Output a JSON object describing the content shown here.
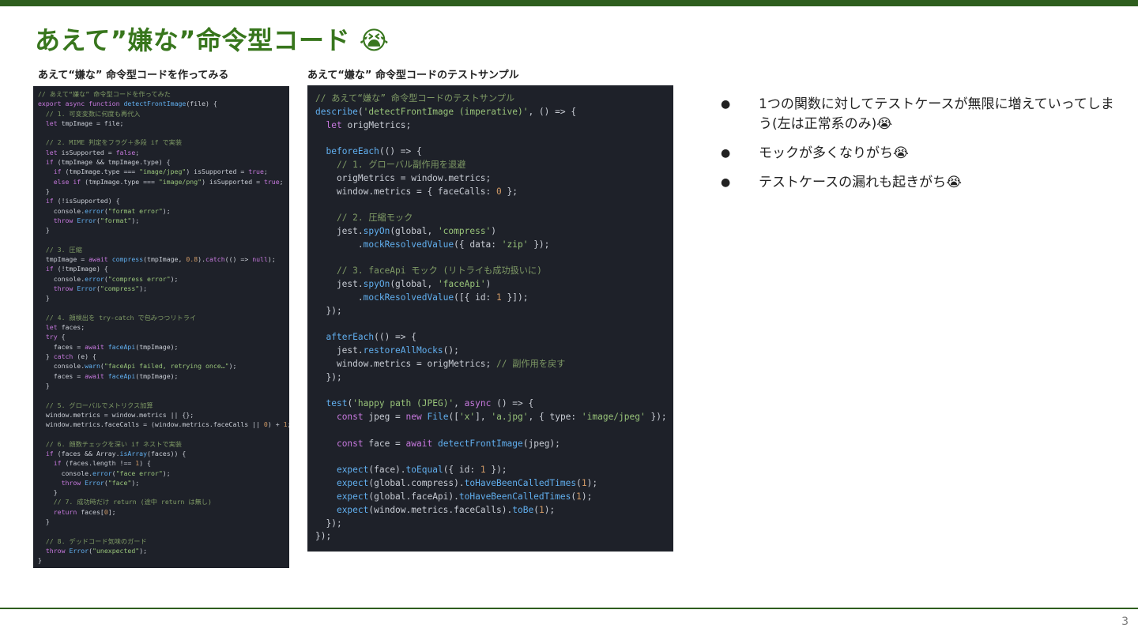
{
  "title": "あえて”嫌な”命令型コード",
  "title_emoji": "😭",
  "left_panel": {
    "caption": "あえて“嫌な” 命令型コードを作ってみる",
    "code_lines": [
      "// あえて“嫌な” 命令型コードを作ってみた",
      "export async function detectFrontImage(file) {",
      "  // 1. 可変変数に何度も再代入",
      "  let tmpImage = file;",
      "",
      "  // 2. MIME 判定をフラグ＋多段 if で実装",
      "  let isSupported = false;",
      "  if (tmpImage && tmpImage.type) {",
      "    if (tmpImage.type === \"image/jpeg\") isSupported = true;",
      "    else if (tmpImage.type === \"image/png\") isSupported = true;",
      "  }",
      "  if (!isSupported) {",
      "    console.error(\"format error\");",
      "    throw Error(\"format\");",
      "  }",
      "",
      "  // 3. 圧縮",
      "  tmpImage = await compress(tmpImage, 0.8).catch(() => null);",
      "  if (!tmpImage) {",
      "    console.error(\"compress error\");",
      "    throw Error(\"compress\");",
      "  }",
      "",
      "  // 4. 顔検出を try-catch で包みつつリトライ",
      "  let faces;",
      "  try {",
      "    faces = await faceApi(tmpImage);",
      "  } catch (e) {",
      "    console.warn(\"faceApi failed, retrying once…\");",
      "    faces = await faceApi(tmpImage);",
      "  }",
      "",
      "  // 5. グローバルでメトリクス加算",
      "  window.metrics = window.metrics || {};",
      "  window.metrics.faceCalls = (window.metrics.faceCalls || 0) + 1;",
      "",
      "  // 6. 顔数チェックを深い if ネストで実装",
      "  if (faces && Array.isArray(faces)) {",
      "    if (faces.length !== 1) {",
      "      console.error(\"face error\");",
      "      throw Error(\"face\");",
      "    }",
      "    // 7. 成功時だけ return (途中 return は無し)",
      "    return faces[0];",
      "  }",
      "",
      "  // 8. デッドコード気味のガード",
      "  throw Error(\"unexpected\");",
      "}"
    ]
  },
  "mid_panel": {
    "caption": "あえて“嫌な” 命令型コードのテストサンプル",
    "code_lines": [
      "// あえて“嫌な” 命令型コードのテストサンプル",
      "describe('detectFrontImage (imperative)', () => {",
      "  let origMetrics;",
      "",
      "  beforeEach(() => {",
      "    // 1. グローバル副作用を退避",
      "    origMetrics = window.metrics;",
      "    window.metrics = { faceCalls: 0 };",
      "",
      "    // 2. 圧縮モック",
      "    jest.spyOn(global, 'compress')",
      "        .mockResolvedValue({ data: 'zip' });",
      "",
      "    // 3. faceApi モック (リトライも成功扱いに)",
      "    jest.spyOn(global, 'faceApi')",
      "        .mockResolvedValue([{ id: 1 }]);",
      "  });",
      "",
      "  afterEach(() => {",
      "    jest.restoreAllMocks();",
      "    window.metrics = origMetrics; // 副作用を戻す",
      "  });",
      "",
      "  test('happy path (JPEG)', async () => {",
      "    const jpeg = new File(['x'], 'a.jpg', { type: 'image/jpeg' });",
      "",
      "    const face = await detectFrontImage(jpeg);",
      "",
      "    expect(face).toEqual({ id: 1 });",
      "    expect(global.compress).toHaveBeenCalledTimes(1);",
      "    expect(global.faceApi).toHaveBeenCalledTimes(1);",
      "    expect(window.metrics.faceCalls).toBe(1);",
      "  });",
      "});"
    ]
  },
  "bullets": [
    "1つの関数に対してテストケースが無限に増えていってしまう(左は正常系のみ)😭",
    "モックが多くなりがち😭",
    "テストケースの漏れも起きがち😭"
  ],
  "bullet_marker": "●",
  "page_number": "3",
  "colors": {
    "accent_green": "#38761d",
    "bar_green": "#2e5e1e",
    "code_background": "#1e2129",
    "code_text": "#c8ccd4",
    "code_comment": "#7f9a65",
    "code_keyword": "#c678dd",
    "code_string": "#98c379",
    "code_function": "#61afef",
    "code_number": "#d19a66"
  }
}
